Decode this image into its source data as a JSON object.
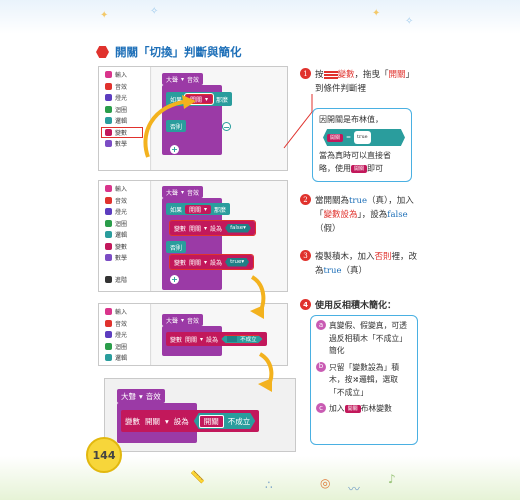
{
  "title": "開關「切換」判斷與簡化",
  "page_number": "144",
  "palette": [
    "輸入",
    "音效",
    "燈光",
    "迴圈",
    "邏輯",
    "變數",
    "數學",
    "進階"
  ],
  "blocks": {
    "event": "大聲",
    "event_suffix": "音效",
    "if_label": "如果",
    "then_label": "那麼",
    "else_label": "否則",
    "var_label": "變數",
    "var_name": "開關",
    "set_label": "設為",
    "false_val": "false",
    "true_val": "true",
    "not_label": "不成立",
    "cmp_eq": "=",
    "cmp_true": "true"
  },
  "steps": {
    "s1_pre": "按",
    "s1_var": "變數",
    "s1_mid": "，拖曳「",
    "s1_name": "開關",
    "s1_post": "」到條件判斷裡",
    "note_line1": "因開關是布林值，",
    "note_line2": "當為真時可以直接省略，使用",
    "note_line3": "即可",
    "s2_pre": "當開關為",
    "s2_true": "true",
    "s2_a": "（真），加入「",
    "s2_set": "變數設為",
    "s2_b": "」，設為",
    "s2_false": "false",
    "s2_c": "（假）",
    "s3_pre": "複製積木，加入",
    "s3_else": "否則",
    "s3_a": "裡，改為",
    "s3_true": "true",
    "s3_b": "（真）",
    "s4": "使用反相積木簡化：",
    "a_pre": "真變假、假變真，可透過",
    "a_red": "反相積木",
    "a_q1": "「",
    "a_not": "不成立",
    "a_post": "」簡化",
    "b_pre": "只留「變數設為」積木，按",
    "b_logic": "邏輯",
    "b_mid": "，選取「",
    "b_not": "不成立",
    "b_post": "」",
    "c_pre": "加入",
    "c_post": "布林變數"
  },
  "colors": {
    "event": "#9b3aa6",
    "logic": "#2a9d9d",
    "variable": "#c2185b",
    "accent": "#e0322d",
    "blue": "#1d6fb8"
  }
}
